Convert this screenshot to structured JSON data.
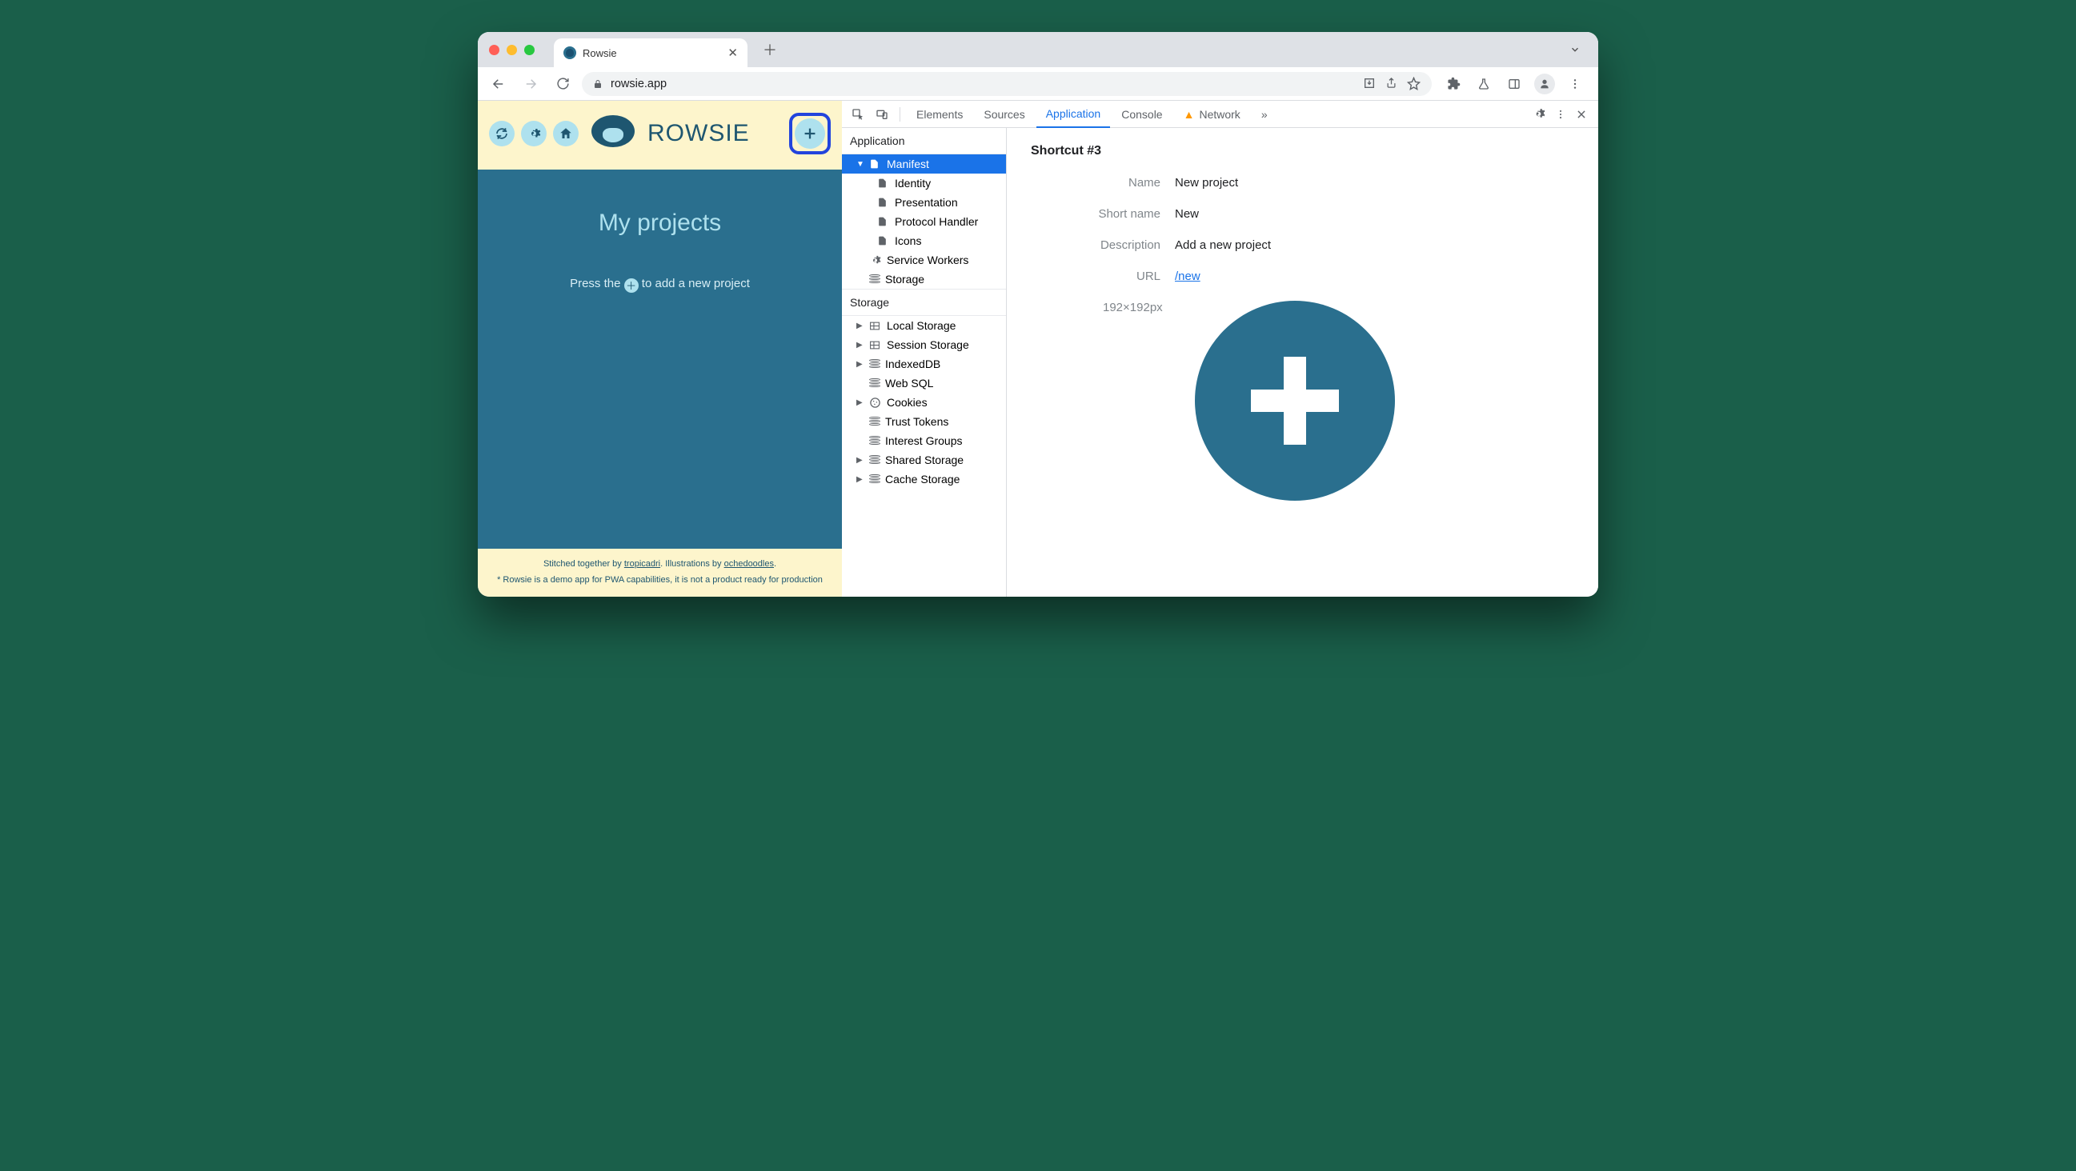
{
  "browser": {
    "tab_title": "Rowsie",
    "url": "rowsie.app"
  },
  "rowsie": {
    "brand": "ROWSIE",
    "page_title": "My projects",
    "empty_prefix": "Press the ",
    "empty_suffix": " to add a new project",
    "footer_line1_a": "Stitched together by ",
    "footer_link1": "tropicadri",
    "footer_line1_b": ". Illustrations by ",
    "footer_link2": "ochedoodles",
    "footer_line1_c": ".",
    "footer_line2": "* Rowsie is a demo app for PWA capabilities, it is not a product ready for production"
  },
  "devtools": {
    "tabs": [
      "Elements",
      "Sources",
      "Application",
      "Console",
      "Network"
    ],
    "active_tab": "Application",
    "more": "»",
    "sidebar": {
      "section1_title": "Application",
      "items1": [
        "Manifest",
        "Identity",
        "Presentation",
        "Protocol Handler",
        "Icons",
        "Service Workers",
        "Storage"
      ],
      "section2_title": "Storage",
      "items2": [
        "Local Storage",
        "Session Storage",
        "IndexedDB",
        "Web SQL",
        "Cookies",
        "Trust Tokens",
        "Interest Groups",
        "Shared Storage",
        "Cache Storage"
      ]
    },
    "shortcut": {
      "title": "Shortcut #3",
      "labels": {
        "name": "Name",
        "short_name": "Short name",
        "description": "Description",
        "url": "URL"
      },
      "name": "New project",
      "short_name": "New",
      "description": "Add a new project",
      "url": "/new",
      "icon_dimensions": "192×192px"
    }
  }
}
